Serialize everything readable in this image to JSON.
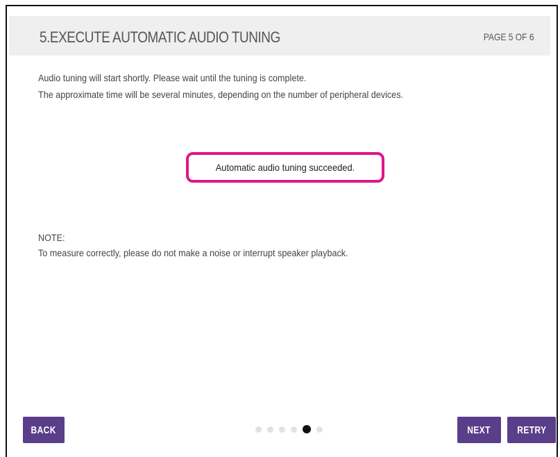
{
  "header": {
    "title": "5.EXECUTE AUTOMATIC AUDIO TUNING",
    "page_indicator": "PAGE 5 OF 6"
  },
  "intro": {
    "line1": "Audio tuning will start shortly. Please wait until the tuning is complete.",
    "line2": "The approximate time will be several minutes, depending on the number of peripheral devices."
  },
  "status": {
    "message": "Automatic audio tuning succeeded.",
    "highlight_color": "#e0168a"
  },
  "note": {
    "label": "NOTE:",
    "text": "To measure correctly, please do not make a noise or interrupt speaker playback."
  },
  "footer": {
    "back_label": "BACK",
    "next_label": "NEXT",
    "retry_label": "RETRY",
    "button_color": "#5b3e8a",
    "pagination": {
      "total": 6,
      "current": 5
    }
  }
}
